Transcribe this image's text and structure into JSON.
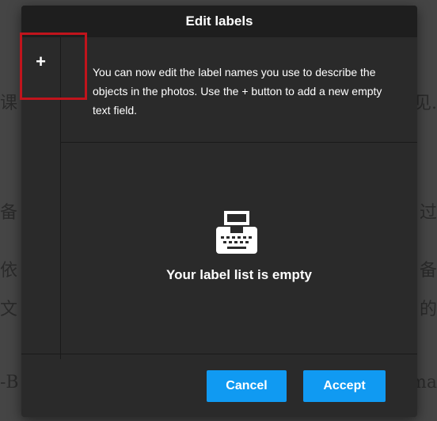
{
  "background": {
    "left_glyphs": [
      "课",
      "备",
      "依",
      "文",
      "-B"
    ],
    "right_glyphs": [
      "见.",
      "过",
      "备",
      "的",
      "ma"
    ]
  },
  "dialog": {
    "title": "Edit labels",
    "add_button_label": "+",
    "info_text": "You can now edit the label names you use to describe the objects in the photos. Use the + button to add a new empty text field.",
    "empty_state": {
      "icon": "typewriter-icon",
      "text": "Your label list is empty"
    },
    "buttons": {
      "cancel": "Cancel",
      "accept": "Accept"
    }
  },
  "colors": {
    "accent": "#109af2",
    "highlight": "#c0141c",
    "dialog_bg": "#2a2a2a",
    "header_bg": "#1e1e1e"
  }
}
